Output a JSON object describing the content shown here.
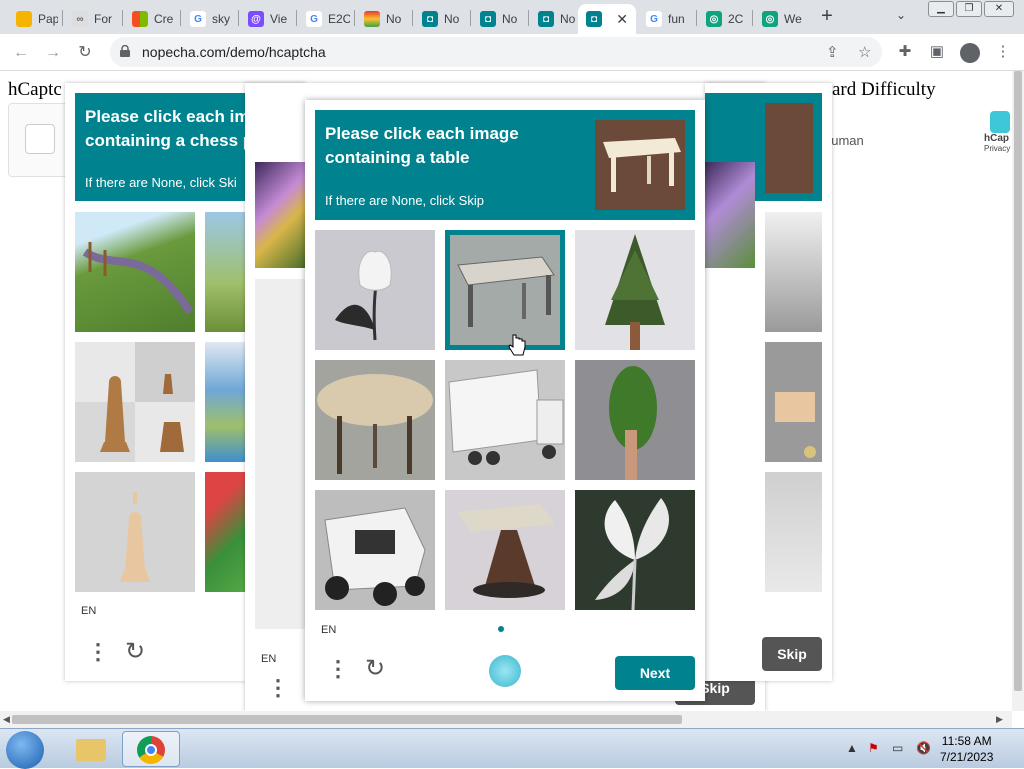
{
  "tabs": [
    {
      "label": "Pap",
      "color": "#f4b400"
    },
    {
      "label": "For",
      "color": "#9e9e9e"
    },
    {
      "label": "Cre",
      "color": "#f25022"
    },
    {
      "label": "sky",
      "color": "#4285f4"
    },
    {
      "label": "Vie",
      "color": "#7c4dff"
    },
    {
      "label": "E2C",
      "color": "#4285f4"
    },
    {
      "label": "No",
      "color": "#e53935"
    },
    {
      "label": "No",
      "color": "#00838f"
    },
    {
      "label": "No",
      "color": "#00838f"
    },
    {
      "label": "No",
      "color": "#00838f"
    },
    {
      "label": "",
      "color": "#00838f"
    },
    {
      "label": "fun",
      "color": "#4285f4"
    },
    {
      "label": "2C",
      "color": "#10a37f"
    },
    {
      "label": "We",
      "color": "#10a37f"
    }
  ],
  "active_tab_close": "✕",
  "new_tab": "+",
  "tab_menu": "⌄",
  "url": "nopecha.com/demo/hcaptcha",
  "page": {
    "heading_left": "hCaptc",
    "heading_right": "ard Difficulty",
    "human_text": "human",
    "hcaptcha_logo": "hCap",
    "privacy": "Privacy"
  },
  "back_panel": {
    "prompt": "Please click each im containing a chess p",
    "sub": "If there are None, click Ski",
    "lang": "EN"
  },
  "mid_panel": {
    "lang": "EN",
    "skip": "Skip"
  },
  "right_panel": {
    "skip": "Skip"
  },
  "challenge": {
    "title": "Please click each image containing a table",
    "sub": "If there are None, click Skip",
    "lang": "EN",
    "next": "Next",
    "grid": [
      {
        "name": "tulip",
        "selected": false
      },
      {
        "name": "table",
        "selected": true
      },
      {
        "name": "tree",
        "selected": false
      },
      {
        "name": "round-table",
        "selected": false
      },
      {
        "name": "truck",
        "selected": false
      },
      {
        "name": "tree",
        "selected": false
      },
      {
        "name": "truck",
        "selected": false
      },
      {
        "name": "table",
        "selected": false
      },
      {
        "name": "flower",
        "selected": false
      }
    ]
  },
  "taskbar": {
    "time": "11:58 AM",
    "date": "7/21/2023"
  }
}
